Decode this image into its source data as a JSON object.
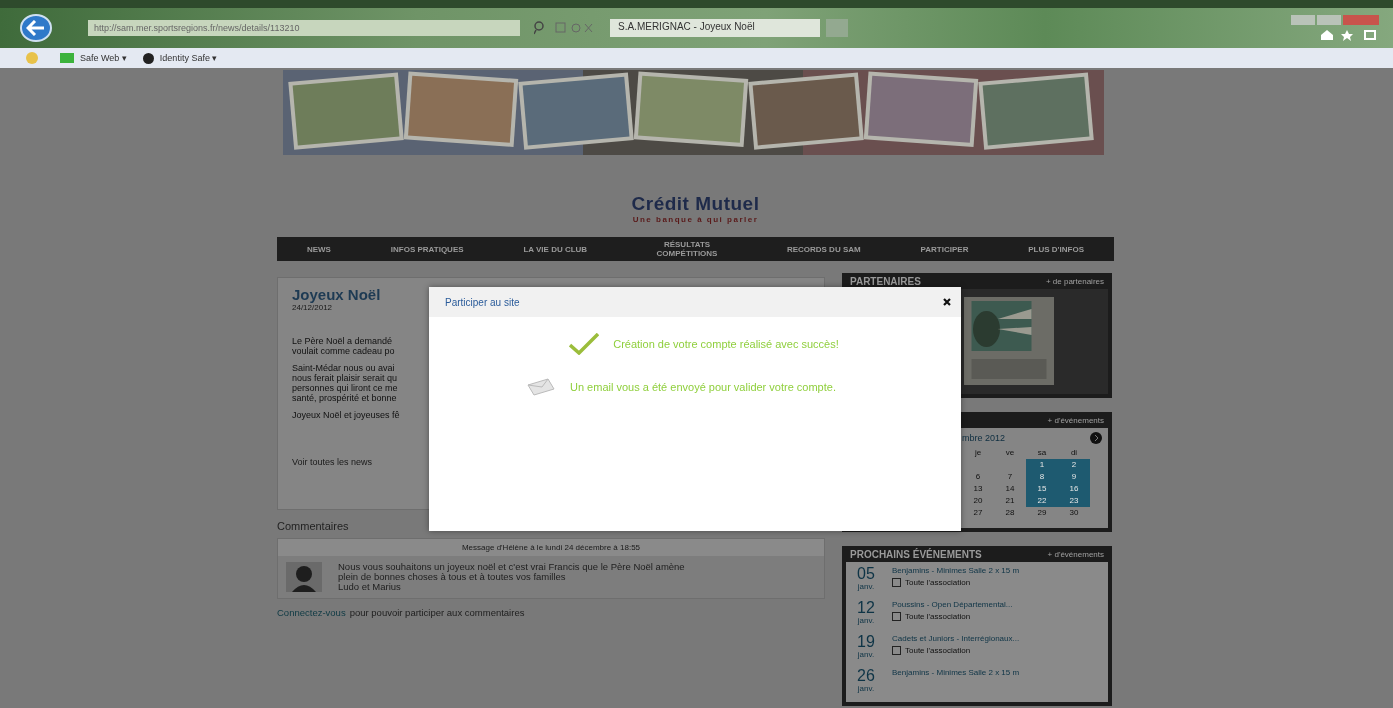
{
  "browser": {
    "address": "http://sam.mer.sportsregions.fr/news/details/113210",
    "tab_title": "S.A.MERIGNAC - Joyeux Noël",
    "favorites": [
      "Safe Web ▾",
      "Identity Safe ▾"
    ]
  },
  "sponsor": {
    "name": "Crédit Mutuel",
    "tagline": "Une banque à qui parler"
  },
  "nav": [
    {
      "label": "NEWS"
    },
    {
      "label": "INFOS PRATIQUES"
    },
    {
      "label": "LA VIE DU CLUB"
    },
    {
      "label": "RÉSULTATS COMPÉTITIONS"
    },
    {
      "label": "RECORDS DU SAM"
    },
    {
      "label": "PARTICIPER"
    },
    {
      "label": "PLUS D'INFOS"
    }
  ],
  "article": {
    "title": "Joyeux Noël",
    "date": "24/12/2012",
    "paragraphs": [
      [
        "Le Père Noël a demandé",
        "voulait comme cadeau po"
      ],
      [
        "Saint-Médar nous ou avai",
        "nous ferait plaisir serait qu",
        "personnes qui liront ce me",
        "santé, prospérité et bonne"
      ],
      [
        "Joyeux Noël et joyeuses fê"
      ]
    ],
    "more_link": "Voir toutes les news"
  },
  "comments": {
    "title": "Commentaires",
    "items": [
      {
        "header": "Message d'Hélène à le lundi 24 décembre à 18:55",
        "lines": [
          "Nous vous souhaitons un joyeux noël et c'est vrai Francis que le Père Noël amène",
          "plein de bonnes choses à tous et à toutes vos familles",
          "Ludo et Marius"
        ]
      }
    ],
    "login_link": "Connectez-vous",
    "login_text": "pour pouvoir participer aux commentaires"
  },
  "partners": {
    "title": "PARTENAIRES",
    "more": "+ de partenaires"
  },
  "calendar": {
    "more": "+ d'événements",
    "month": "mbre 2012",
    "weekdays": [
      "je",
      "ve",
      "sa",
      "di"
    ],
    "weeks": [
      {
        "days": [
          "1",
          "2"
        ],
        "highlighted": true
      },
      {
        "days": [
          "6",
          "7",
          "8",
          "9"
        ],
        "highlighted": true
      },
      {
        "days": [
          "13",
          "14",
          "15",
          "16"
        ],
        "highlighted": true
      },
      {
        "days": [
          "20",
          "21",
          "22",
          "23"
        ],
        "highlighted": true
      },
      {
        "days": [
          "27",
          "28",
          "29",
          "30"
        ],
        "highlighted": false
      }
    ]
  },
  "events": {
    "title": "PROCHAINS ÉVÉNEMENTS",
    "more": "+ d'événements",
    "items": [
      {
        "day": "05",
        "month": "janv.",
        "name": "Benjamins - Minimes Salle 2 x 15 m",
        "scope": "Toute l'association"
      },
      {
        "day": "12",
        "month": "janv.",
        "name": "Poussins - Open Départemental...",
        "scope": "Toute l'association"
      },
      {
        "day": "19",
        "month": "janv.",
        "name": "Cadets et Juniors - Interrégionaux...",
        "scope": "Toute l'association"
      },
      {
        "day": "26",
        "month": "janv.",
        "name": "Benjamins - Minimes Salle 2 x 15 m"
      }
    ]
  },
  "modal": {
    "title": "Participer au site",
    "messages": [
      {
        "kind": "success",
        "text": "Création de votre compte réalisé avec succès!"
      },
      {
        "kind": "email",
        "text": "Un email vous a été envoyé pour valider votre compte."
      }
    ]
  }
}
